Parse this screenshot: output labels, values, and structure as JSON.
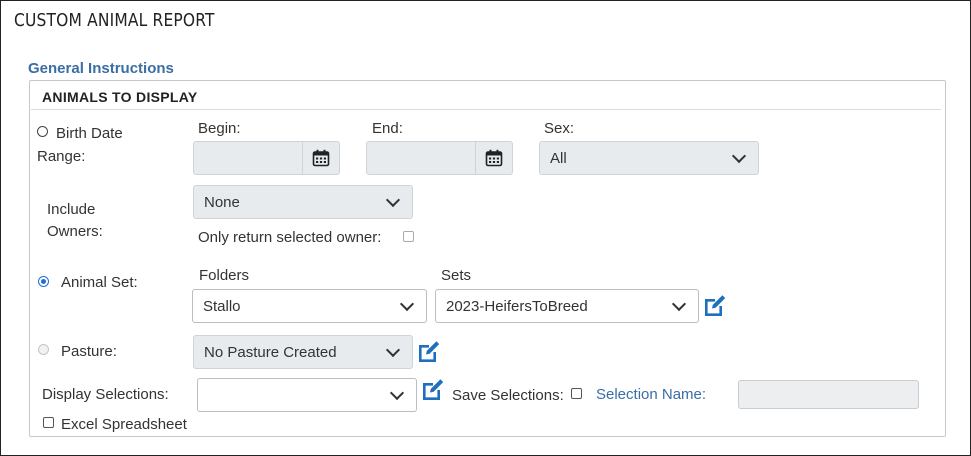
{
  "page": {
    "title": "CUSTOM ANIMAL REPORT",
    "instructions_link": "General Instructions"
  },
  "panel": {
    "title": "ANIMALS TO DISPLAY"
  },
  "birth_date": {
    "label_line1": "Birth Date",
    "label_line2": "Range:",
    "selected": false,
    "begin_label": "Begin:",
    "begin_value": "",
    "end_label": "End:",
    "end_value": "",
    "sex_label": "Sex:",
    "sex_value": "All"
  },
  "owners": {
    "label_line1": "Include",
    "label_line2": "Owners:",
    "value": "None",
    "only_selected_label": "Only return selected owner:",
    "only_selected_checked": false
  },
  "animal_set": {
    "label": "Animal Set:",
    "selected": true,
    "folders_label": "Folders",
    "folder_value": "Stallo",
    "sets_label": "Sets",
    "set_value": "2023-HeifersToBreed"
  },
  "pasture": {
    "label": "Pasture:",
    "selected": false,
    "value": "No Pasture Created"
  },
  "display_selections": {
    "label": "Display Selections:",
    "value": "",
    "save_label": "Save Selections:",
    "save_checked": false,
    "selection_name_label": "Selection Name:",
    "selection_name_value": ""
  },
  "excel": {
    "label": "Excel Spreadsheet",
    "checked": false
  },
  "colors": {
    "accent": "#3a6ea5",
    "edit_icon": "#1f6fbf",
    "field_bg": "#e8ebee"
  }
}
